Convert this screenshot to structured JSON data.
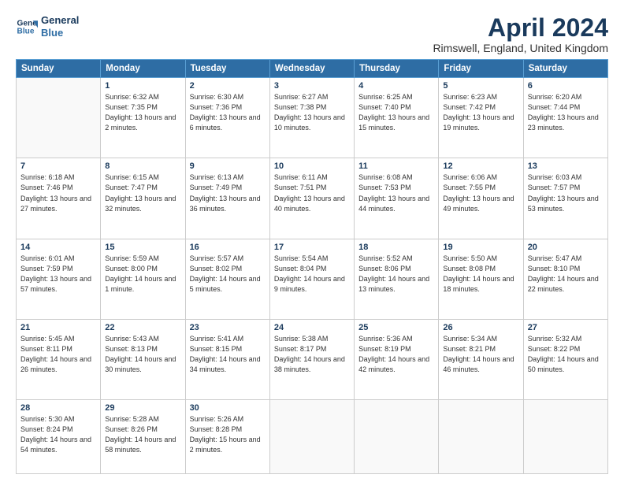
{
  "header": {
    "logo_line1": "General",
    "logo_line2": "Blue",
    "title": "April 2024",
    "subtitle": "Rimswell, England, United Kingdom"
  },
  "weekdays": [
    "Sunday",
    "Monday",
    "Tuesday",
    "Wednesday",
    "Thursday",
    "Friday",
    "Saturday"
  ],
  "weeks": [
    [
      {
        "day": "",
        "sunrise": "",
        "sunset": "",
        "daylight": ""
      },
      {
        "day": "1",
        "sunrise": "Sunrise: 6:32 AM",
        "sunset": "Sunset: 7:35 PM",
        "daylight": "Daylight: 13 hours and 2 minutes."
      },
      {
        "day": "2",
        "sunrise": "Sunrise: 6:30 AM",
        "sunset": "Sunset: 7:36 PM",
        "daylight": "Daylight: 13 hours and 6 minutes."
      },
      {
        "day": "3",
        "sunrise": "Sunrise: 6:27 AM",
        "sunset": "Sunset: 7:38 PM",
        "daylight": "Daylight: 13 hours and 10 minutes."
      },
      {
        "day": "4",
        "sunrise": "Sunrise: 6:25 AM",
        "sunset": "Sunset: 7:40 PM",
        "daylight": "Daylight: 13 hours and 15 minutes."
      },
      {
        "day": "5",
        "sunrise": "Sunrise: 6:23 AM",
        "sunset": "Sunset: 7:42 PM",
        "daylight": "Daylight: 13 hours and 19 minutes."
      },
      {
        "day": "6",
        "sunrise": "Sunrise: 6:20 AM",
        "sunset": "Sunset: 7:44 PM",
        "daylight": "Daylight: 13 hours and 23 minutes."
      }
    ],
    [
      {
        "day": "7",
        "sunrise": "Sunrise: 6:18 AM",
        "sunset": "Sunset: 7:46 PM",
        "daylight": "Daylight: 13 hours and 27 minutes."
      },
      {
        "day": "8",
        "sunrise": "Sunrise: 6:15 AM",
        "sunset": "Sunset: 7:47 PM",
        "daylight": "Daylight: 13 hours and 32 minutes."
      },
      {
        "day": "9",
        "sunrise": "Sunrise: 6:13 AM",
        "sunset": "Sunset: 7:49 PM",
        "daylight": "Daylight: 13 hours and 36 minutes."
      },
      {
        "day": "10",
        "sunrise": "Sunrise: 6:11 AM",
        "sunset": "Sunset: 7:51 PM",
        "daylight": "Daylight: 13 hours and 40 minutes."
      },
      {
        "day": "11",
        "sunrise": "Sunrise: 6:08 AM",
        "sunset": "Sunset: 7:53 PM",
        "daylight": "Daylight: 13 hours and 44 minutes."
      },
      {
        "day": "12",
        "sunrise": "Sunrise: 6:06 AM",
        "sunset": "Sunset: 7:55 PM",
        "daylight": "Daylight: 13 hours and 49 minutes."
      },
      {
        "day": "13",
        "sunrise": "Sunrise: 6:03 AM",
        "sunset": "Sunset: 7:57 PM",
        "daylight": "Daylight: 13 hours and 53 minutes."
      }
    ],
    [
      {
        "day": "14",
        "sunrise": "Sunrise: 6:01 AM",
        "sunset": "Sunset: 7:59 PM",
        "daylight": "Daylight: 13 hours and 57 minutes."
      },
      {
        "day": "15",
        "sunrise": "Sunrise: 5:59 AM",
        "sunset": "Sunset: 8:00 PM",
        "daylight": "Daylight: 14 hours and 1 minute."
      },
      {
        "day": "16",
        "sunrise": "Sunrise: 5:57 AM",
        "sunset": "Sunset: 8:02 PM",
        "daylight": "Daylight: 14 hours and 5 minutes."
      },
      {
        "day": "17",
        "sunrise": "Sunrise: 5:54 AM",
        "sunset": "Sunset: 8:04 PM",
        "daylight": "Daylight: 14 hours and 9 minutes."
      },
      {
        "day": "18",
        "sunrise": "Sunrise: 5:52 AM",
        "sunset": "Sunset: 8:06 PM",
        "daylight": "Daylight: 14 hours and 13 minutes."
      },
      {
        "day": "19",
        "sunrise": "Sunrise: 5:50 AM",
        "sunset": "Sunset: 8:08 PM",
        "daylight": "Daylight: 14 hours and 18 minutes."
      },
      {
        "day": "20",
        "sunrise": "Sunrise: 5:47 AM",
        "sunset": "Sunset: 8:10 PM",
        "daylight": "Daylight: 14 hours and 22 minutes."
      }
    ],
    [
      {
        "day": "21",
        "sunrise": "Sunrise: 5:45 AM",
        "sunset": "Sunset: 8:11 PM",
        "daylight": "Daylight: 14 hours and 26 minutes."
      },
      {
        "day": "22",
        "sunrise": "Sunrise: 5:43 AM",
        "sunset": "Sunset: 8:13 PM",
        "daylight": "Daylight: 14 hours and 30 minutes."
      },
      {
        "day": "23",
        "sunrise": "Sunrise: 5:41 AM",
        "sunset": "Sunset: 8:15 PM",
        "daylight": "Daylight: 14 hours and 34 minutes."
      },
      {
        "day": "24",
        "sunrise": "Sunrise: 5:38 AM",
        "sunset": "Sunset: 8:17 PM",
        "daylight": "Daylight: 14 hours and 38 minutes."
      },
      {
        "day": "25",
        "sunrise": "Sunrise: 5:36 AM",
        "sunset": "Sunset: 8:19 PM",
        "daylight": "Daylight: 14 hours and 42 minutes."
      },
      {
        "day": "26",
        "sunrise": "Sunrise: 5:34 AM",
        "sunset": "Sunset: 8:21 PM",
        "daylight": "Daylight: 14 hours and 46 minutes."
      },
      {
        "day": "27",
        "sunrise": "Sunrise: 5:32 AM",
        "sunset": "Sunset: 8:22 PM",
        "daylight": "Daylight: 14 hours and 50 minutes."
      }
    ],
    [
      {
        "day": "28",
        "sunrise": "Sunrise: 5:30 AM",
        "sunset": "Sunset: 8:24 PM",
        "daylight": "Daylight: 14 hours and 54 minutes."
      },
      {
        "day": "29",
        "sunrise": "Sunrise: 5:28 AM",
        "sunset": "Sunset: 8:26 PM",
        "daylight": "Daylight: 14 hours and 58 minutes."
      },
      {
        "day": "30",
        "sunrise": "Sunrise: 5:26 AM",
        "sunset": "Sunset: 8:28 PM",
        "daylight": "Daylight: 15 hours and 2 minutes."
      },
      {
        "day": "",
        "sunrise": "",
        "sunset": "",
        "daylight": ""
      },
      {
        "day": "",
        "sunrise": "",
        "sunset": "",
        "daylight": ""
      },
      {
        "day": "",
        "sunrise": "",
        "sunset": "",
        "daylight": ""
      },
      {
        "day": "",
        "sunrise": "",
        "sunset": "",
        "daylight": ""
      }
    ]
  ]
}
